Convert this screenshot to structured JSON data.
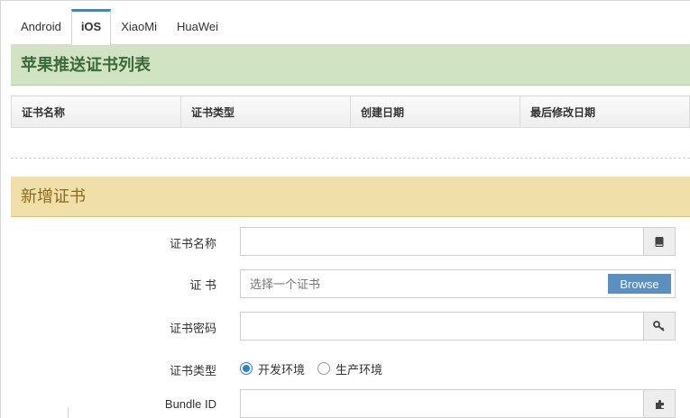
{
  "tabs": [
    {
      "label": "Android",
      "active": false
    },
    {
      "label": "iOS",
      "active": true
    },
    {
      "label": "XiaoMi",
      "active": false
    },
    {
      "label": "HuaWei",
      "active": false
    }
  ],
  "list_section": {
    "title": "苹果推送证书列表",
    "columns": [
      "证书名称",
      "证书类型",
      "创建日期",
      "最后修改日期"
    ],
    "rows": []
  },
  "new_section": {
    "title": "新增证书",
    "fields": {
      "cert_name": {
        "label": "证书名称",
        "value": "",
        "icon": "book-icon"
      },
      "cert_file": {
        "label": "证 书",
        "placeholder": "选择一个证书",
        "button": "Browse"
      },
      "cert_password": {
        "label": "证书密码",
        "value": "",
        "icon": "key-icon"
      },
      "cert_type": {
        "label": "证书类型",
        "options": [
          "开发环境",
          "生产环境"
        ],
        "selected": "开发环境"
      },
      "bundle_id": {
        "label": "Bundle ID",
        "value": "",
        "icon": "puzzle-icon"
      }
    }
  },
  "colors": {
    "list_header_bg": "#d1e3c2",
    "list_header_text": "#3b6b3a",
    "new_header_bg": "#f0dfa8",
    "new_header_text": "#8a6a1f",
    "browse_button": "#5b8fc0",
    "radio_selected": "#2f7fd6"
  }
}
